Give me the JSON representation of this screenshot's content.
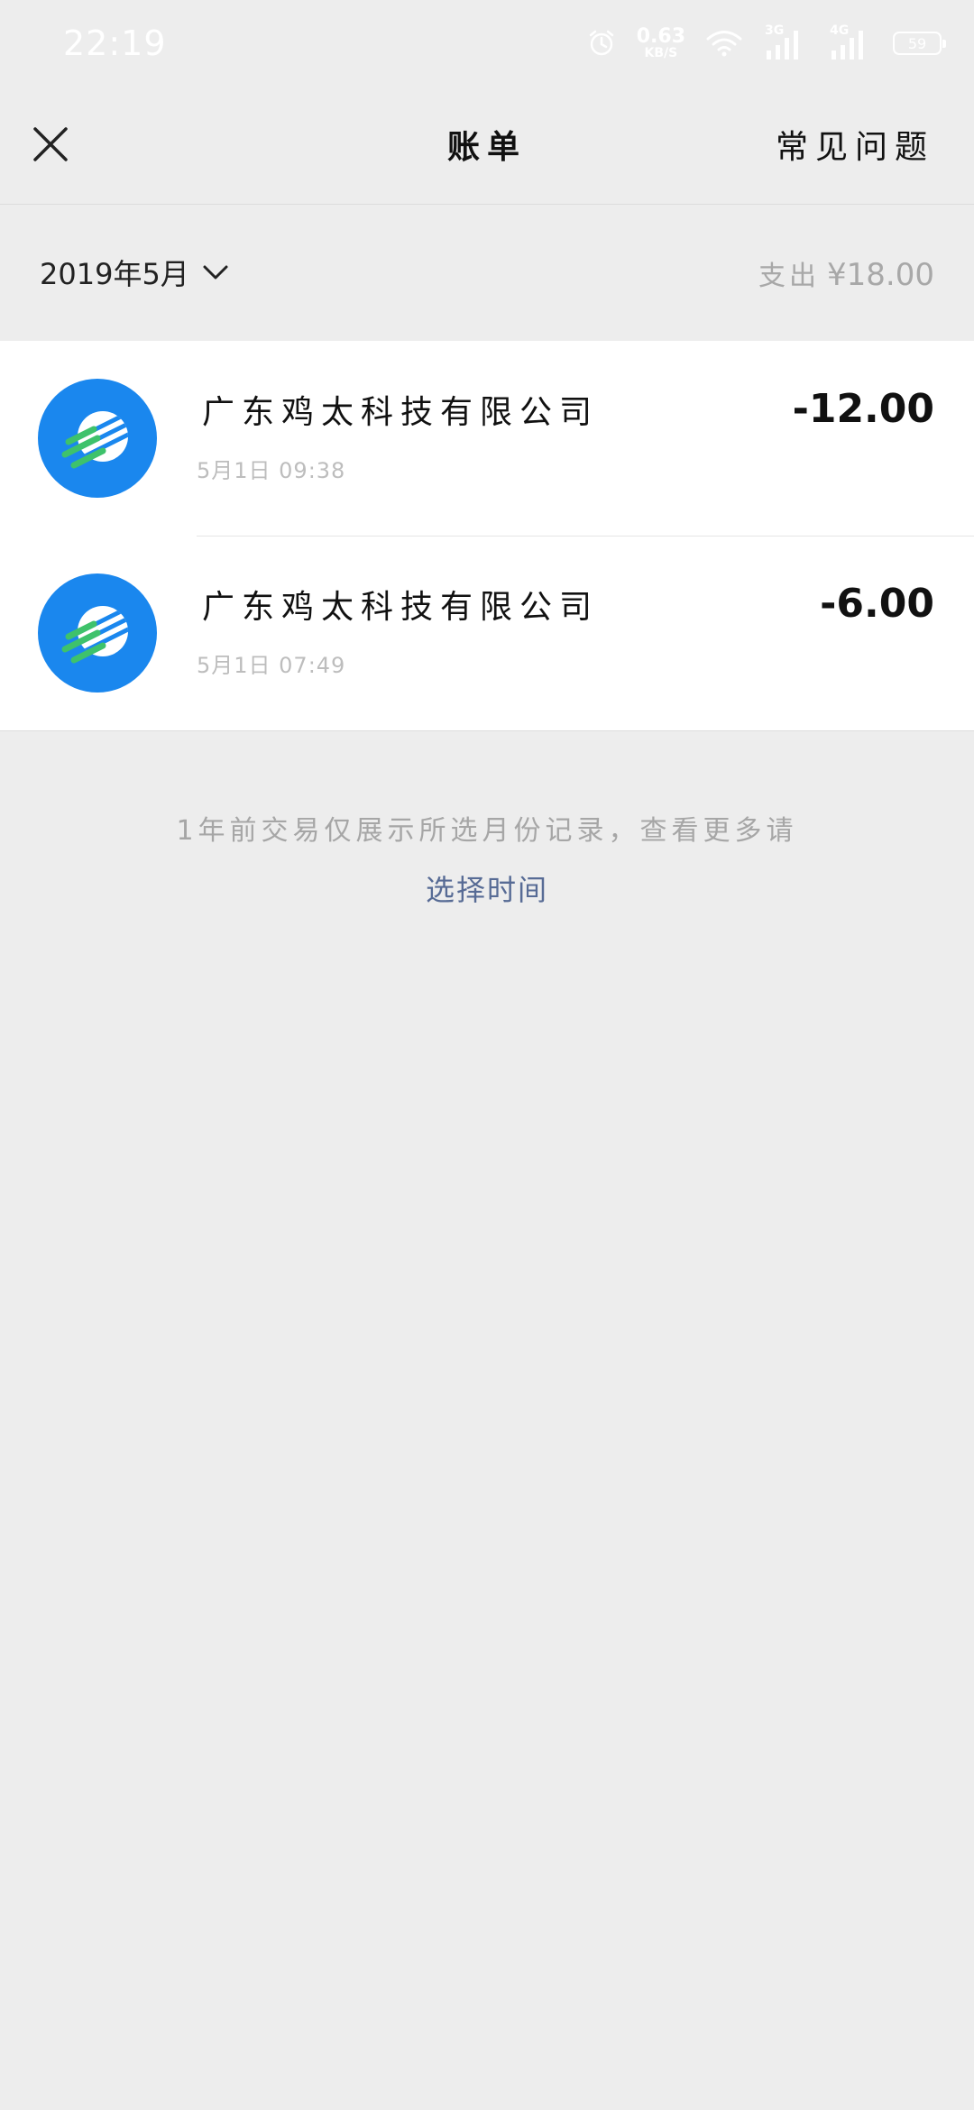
{
  "status_bar": {
    "time": "22:19",
    "net_speed_value": "0.63",
    "net_speed_unit": "KB/S",
    "signal_1_label": "3G",
    "signal_2_label": "4G",
    "battery": "59"
  },
  "header": {
    "title": "账单",
    "faq": "常见问题"
  },
  "filter": {
    "month_label": "2019年5月",
    "expense_label": "支出",
    "expense_amount": "¥18.00"
  },
  "transactions": [
    {
      "merchant": "广东鸡太科技有限公司",
      "time": "5月1日 09:38",
      "amount": "-12.00"
    },
    {
      "merchant": "广东鸡太科技有限公司",
      "time": "5月1日 07:49",
      "amount": "-6.00"
    }
  ],
  "footer": {
    "note": "1年前交易仅展示所选月份记录，查看更多请",
    "link": "选择时间"
  },
  "colors": {
    "background": "#ededed",
    "card": "#ffffff",
    "avatar": "#1a87ee",
    "link": "#576b95",
    "muted": "#a6a6a6"
  }
}
